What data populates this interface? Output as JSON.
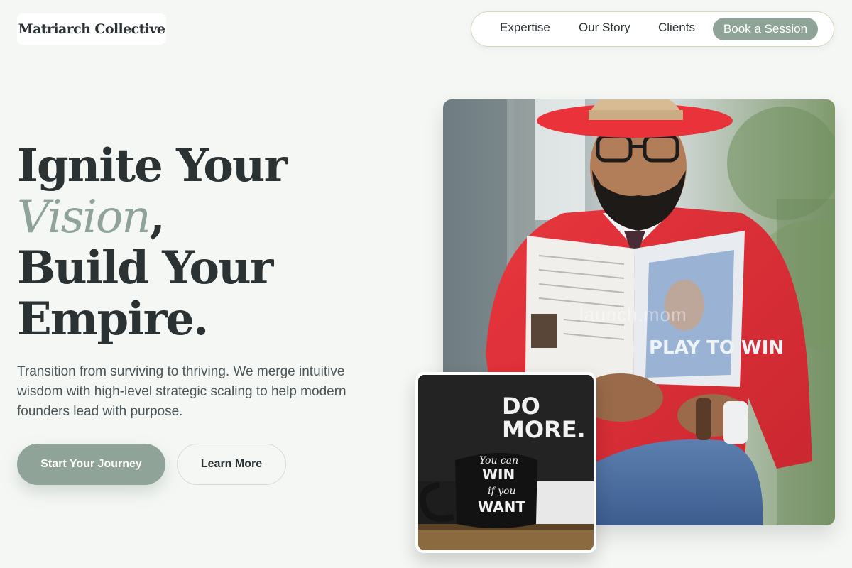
{
  "brand": {
    "name": "Matriarch Collective"
  },
  "nav": {
    "items": [
      "Expertise",
      "Our Story",
      "Clients"
    ],
    "cta": "Book a Session"
  },
  "hero": {
    "headline": {
      "line1": "Ignite Your",
      "accent": "Vision",
      "accent_suffix": ",",
      "line3": "Build Your",
      "line4": "Empire."
    },
    "subtext": "Transition from surviving to thriving. We merge intuitive wisdom with high-level strategic scaling to help modern founders lead with purpose.",
    "primary_button": "Start Your Journey",
    "secondary_button": "Learn More"
  },
  "media": {
    "main_photo": {
      "book_text": "PLAY TO WIN",
      "watermark": "launch.mom"
    },
    "secondary_photo": {
      "sign_line1": "DO",
      "sign_line2": "MORE.",
      "mug_line1": "You can",
      "mug_line2": "WIN",
      "mug_line3": "if you",
      "mug_line4": "WANT"
    }
  },
  "colors": {
    "background": "#f5f7f5",
    "accent": "#8fa398",
    "text": "#2b3234",
    "jacket_red": "#e0313a"
  }
}
